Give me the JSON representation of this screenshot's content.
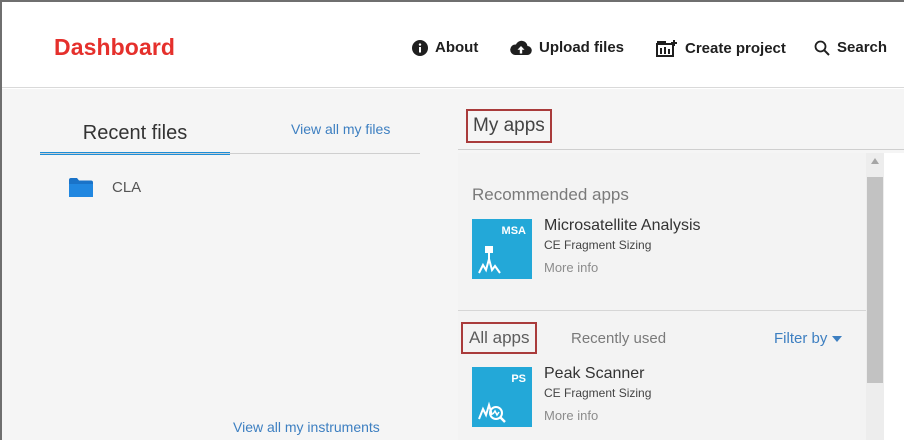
{
  "header": {
    "title": "Dashboard",
    "nav": {
      "about": "About",
      "upload": "Upload files",
      "create": "Create project",
      "search": "Search"
    }
  },
  "left": {
    "tab_label": "Recent files",
    "view_files_link": "View all my files",
    "files": [
      {
        "name": "CLA",
        "icon": "folder-icon"
      }
    ],
    "view_instruments_link": "View all my instruments"
  },
  "right": {
    "tab_label": "My apps",
    "recommended_title": "Recommended apps",
    "recommended": [
      {
        "abbr": "MSA",
        "name": "Microsatellite Analysis",
        "category": "CE Fragment Sizing",
        "more": "More info"
      }
    ],
    "all_tab": "All apps",
    "recent_tab": "Recently used",
    "filter": "Filter by",
    "all": [
      {
        "abbr": "PS",
        "name": "Peak Scanner",
        "category": "CE Fragment Sizing",
        "more": "More info"
      }
    ]
  },
  "colors": {
    "brand": "#e5302c",
    "link": "#3d7fc1",
    "tab_underline": "#1d8ed8",
    "app_icon": "#23a8d8",
    "highlight_box": "#a93b3b"
  }
}
